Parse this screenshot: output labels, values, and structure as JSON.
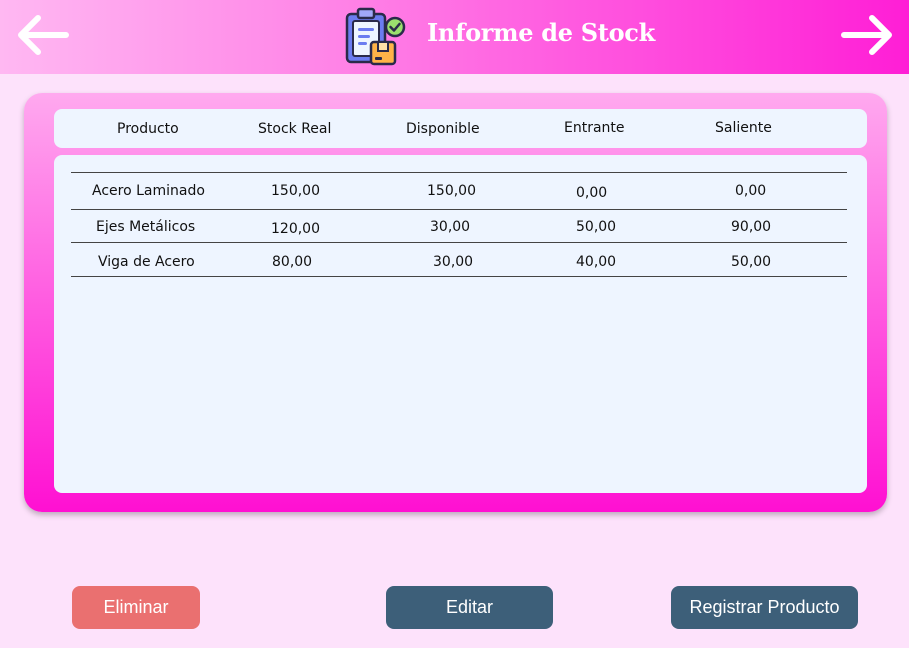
{
  "header": {
    "title": "Informe de Stock",
    "back_icon": "arrow-left-icon",
    "forward_icon": "arrow-right-icon",
    "logo_icon": "clipboard-box-check-icon"
  },
  "table": {
    "columns": [
      "Producto",
      "Stock Real",
      "Disponible",
      "Entrante",
      "Saliente"
    ],
    "rows": [
      [
        "Acero Laminado",
        "150,00",
        "150,00",
        "0,00",
        "0,00"
      ],
      [
        "Ejes Metálicos",
        "120,00",
        "30,00",
        "50,00",
        "90,00"
      ],
      [
        "Viga de Acero",
        "80,00",
        "30,00",
        "40,00",
        "50,00"
      ]
    ]
  },
  "actions": {
    "delete_label": "Eliminar",
    "edit_label": "Editar",
    "register_label": "Registrar Producto"
  },
  "colors": {
    "background": "#fde2fb",
    "header_gradient_start": "#ffb8f2",
    "header_gradient_end": "#ff1ed6",
    "table_background": "#eef5ff",
    "delete_button": "#ea7070",
    "primary_button": "#3d5f79"
  }
}
